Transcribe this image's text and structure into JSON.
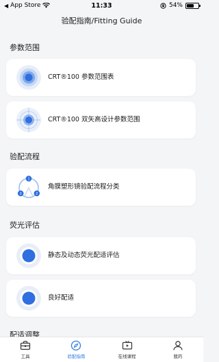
{
  "status_bar": {
    "carrier": "App Store",
    "time": "11:33",
    "battery": "54%"
  },
  "nav": {
    "title": "验配指南/Fitting Guide"
  },
  "sections": [
    {
      "title": "参数范围",
      "cards": [
        {
          "label": "CRT®100 参数范围表",
          "icon": "target-rings-icon"
        },
        {
          "label": "CRT®100 双矢高设计参数范围",
          "icon": "crosshair-target-icon"
        }
      ]
    },
    {
      "title": "验配流程",
      "cards": [
        {
          "label": "角膜塑形镜验配流程分类",
          "icon": "process-cycle-icon"
        }
      ]
    },
    {
      "title": "荧光评估",
      "cards": [
        {
          "label": "静态及动态荧光配适评估",
          "icon": "fluorescein-dot-icon"
        },
        {
          "label": "良好配适",
          "icon": "fluorescein-dot-icon"
        }
      ]
    },
    {
      "title": "配适调整",
      "cards": []
    }
  ],
  "process_icon_numbers": [
    "1",
    "2",
    "3"
  ],
  "tabs": [
    {
      "label": "工具",
      "icon": "toolbox-icon",
      "active": false
    },
    {
      "label": "验配指南",
      "icon": "compass-icon",
      "active": true
    },
    {
      "label": "在线课程",
      "icon": "video-tv-icon",
      "active": false
    },
    {
      "label": "我的",
      "icon": "person-icon",
      "active": false
    }
  ],
  "colors": {
    "accent": "#2f7de1",
    "background": "#f4f5f7",
    "card": "#ffffff"
  }
}
